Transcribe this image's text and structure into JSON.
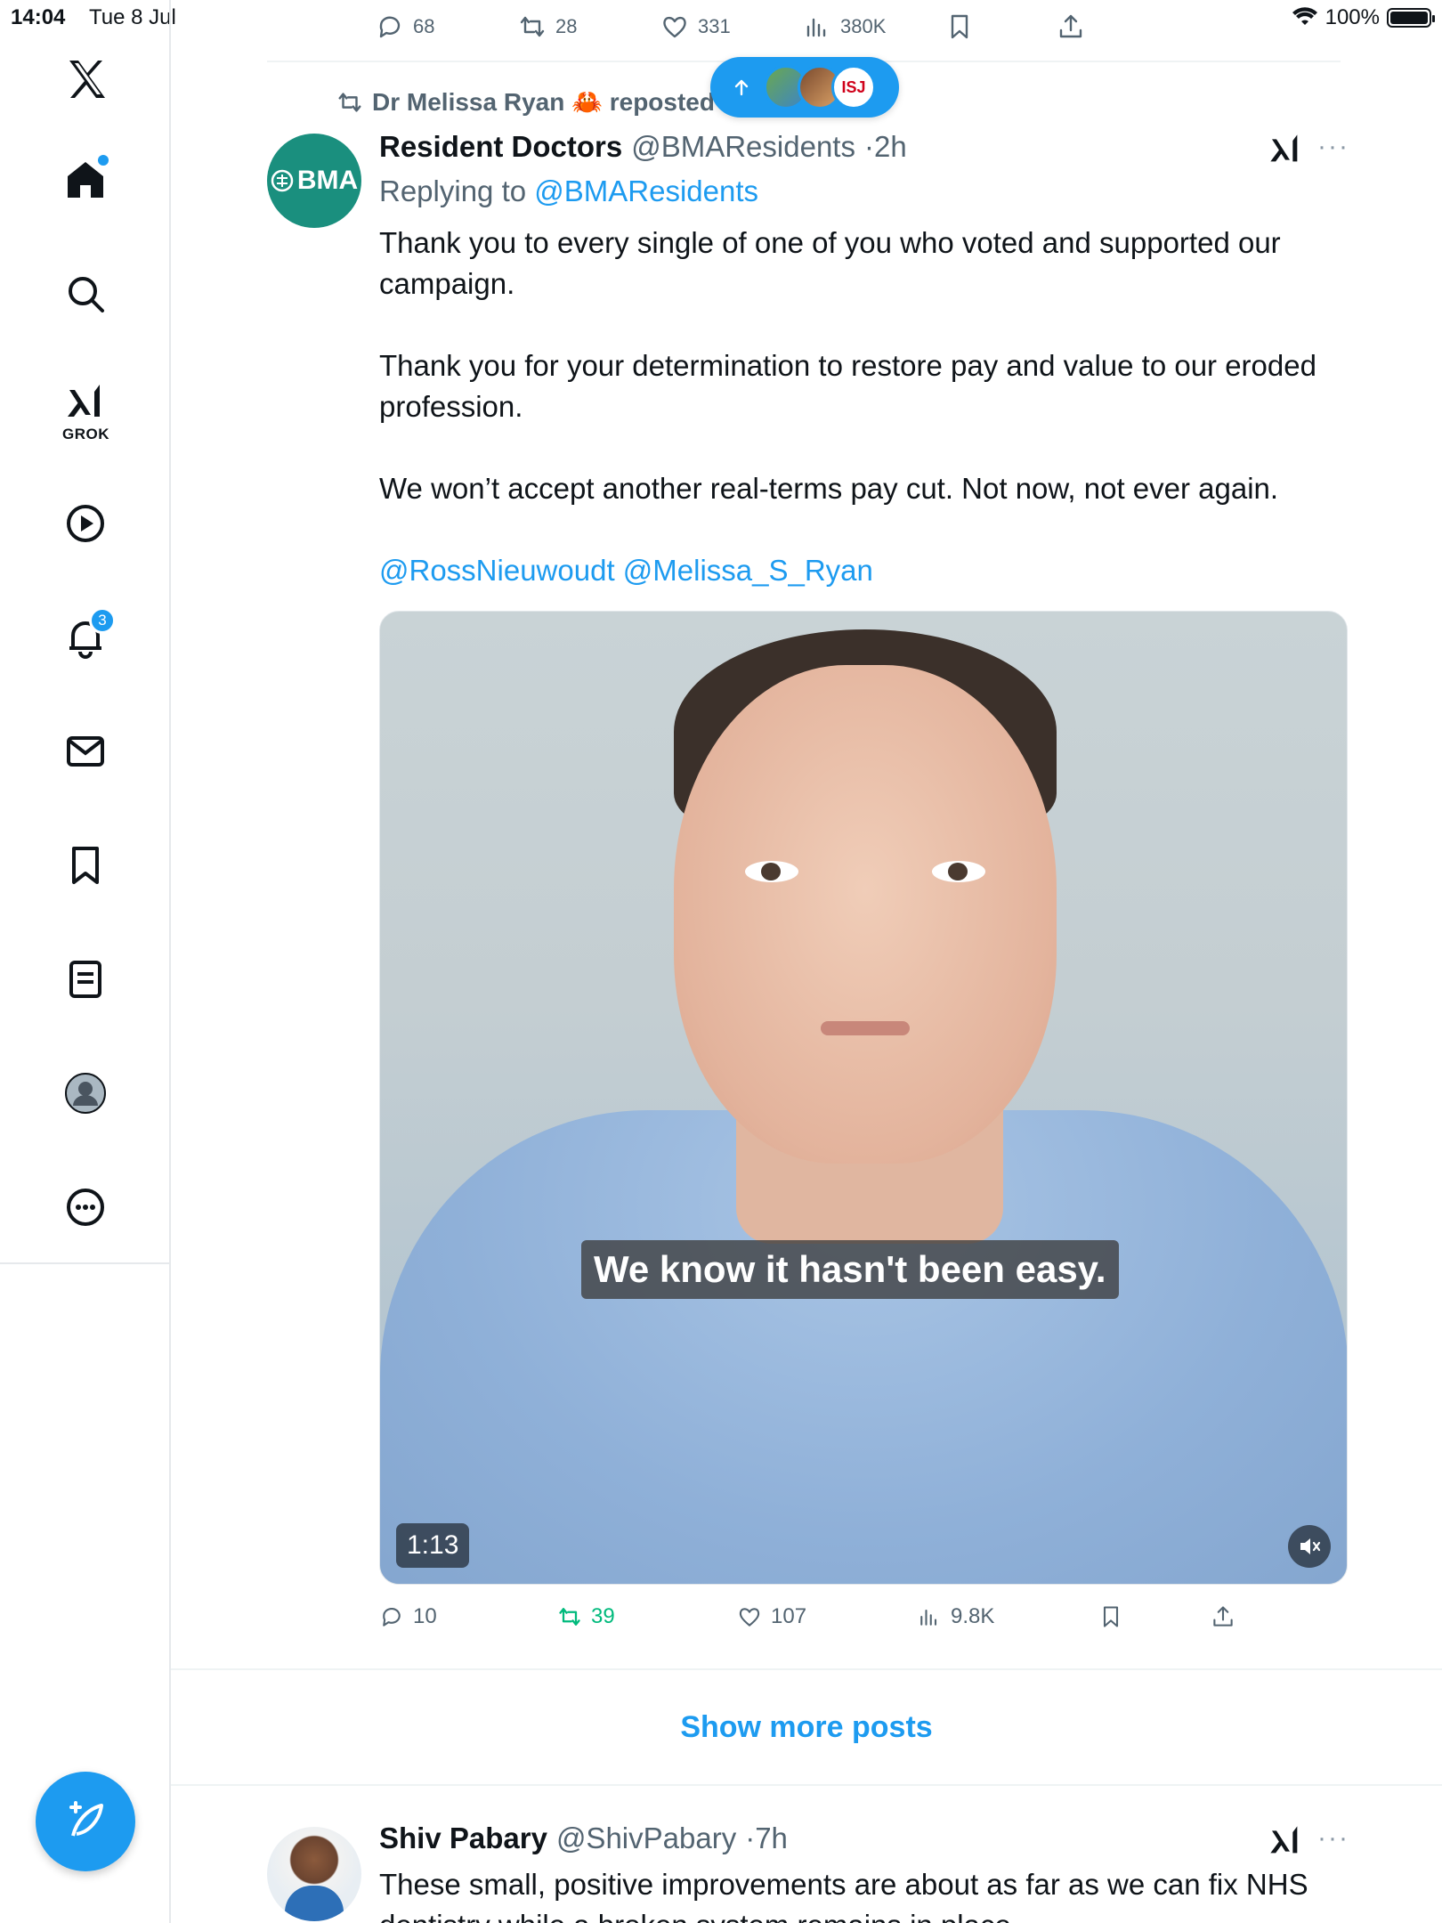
{
  "status_bar": {
    "time": "14:04",
    "date": "Tue 8 Jul",
    "battery": "100%",
    "icons": [
      "wifi-icon",
      "battery-icon"
    ]
  },
  "sidebar": {
    "items": [
      {
        "name": "x-logo",
        "icon": "x-logo-icon"
      },
      {
        "name": "home",
        "icon": "home-icon",
        "unread_dot": true
      },
      {
        "name": "search",
        "icon": "search-icon"
      },
      {
        "name": "grok",
        "icon": "grok-icon",
        "label": "GROK"
      },
      {
        "name": "video",
        "icon": "play-icon"
      },
      {
        "name": "notifications",
        "icon": "bell-icon",
        "badge": "3"
      },
      {
        "name": "messages",
        "icon": "mail-icon"
      },
      {
        "name": "bookmarks",
        "icon": "bookmark-icon"
      },
      {
        "name": "lists",
        "icon": "list-icon"
      },
      {
        "name": "profile",
        "icon": "profile-icon"
      },
      {
        "name": "more",
        "icon": "more-icon"
      }
    ],
    "compose_icon": "compose-icon"
  },
  "previous_tweet_actions": {
    "replies": "68",
    "reposts": "28",
    "likes": "331",
    "views": "380K"
  },
  "new_posts_pill": {
    "icons": [
      "arrow-up-icon"
    ],
    "avatar_text": "ISJ"
  },
  "tweet": {
    "repost_by": "Dr Melissa Ryan 🦀 reposted",
    "avatar_text": "BMA",
    "author_name": "Resident Doctors",
    "author_handle": "@BMAResidents",
    "time": "2h",
    "replying_prefix": "Replying to",
    "replying_to": "@BMAResidents",
    "body": [
      "Thank you to every single of one of you who voted and supported our campaign.",
      "Thank you for your determination to restore pay and value to our eroded profession.",
      "We won’t accept another real-terms pay cut. Not now, not ever again."
    ],
    "mentions": "@RossNieuwoudt @Melissa_S_Ryan",
    "video": {
      "caption": "We know it hasn't been easy.",
      "duration": "1:13",
      "muted": true
    },
    "actions": {
      "replies": "10",
      "reposts": "39",
      "likes": "107",
      "views": "9.8K"
    }
  },
  "show_more_label": "Show more posts",
  "next_tweet": {
    "author_name": "Shiv Pabary",
    "author_handle": "@ShivPabary",
    "time": "7h",
    "body": "These small, positive improvements are about as far as we can fix NHS dentistry while a broken system remains in place."
  },
  "colors": {
    "accent": "#1d9bf0",
    "repost_green": "#00ba7c",
    "secondary_text": "#536471",
    "bma_teal": "#1a8f7e"
  }
}
